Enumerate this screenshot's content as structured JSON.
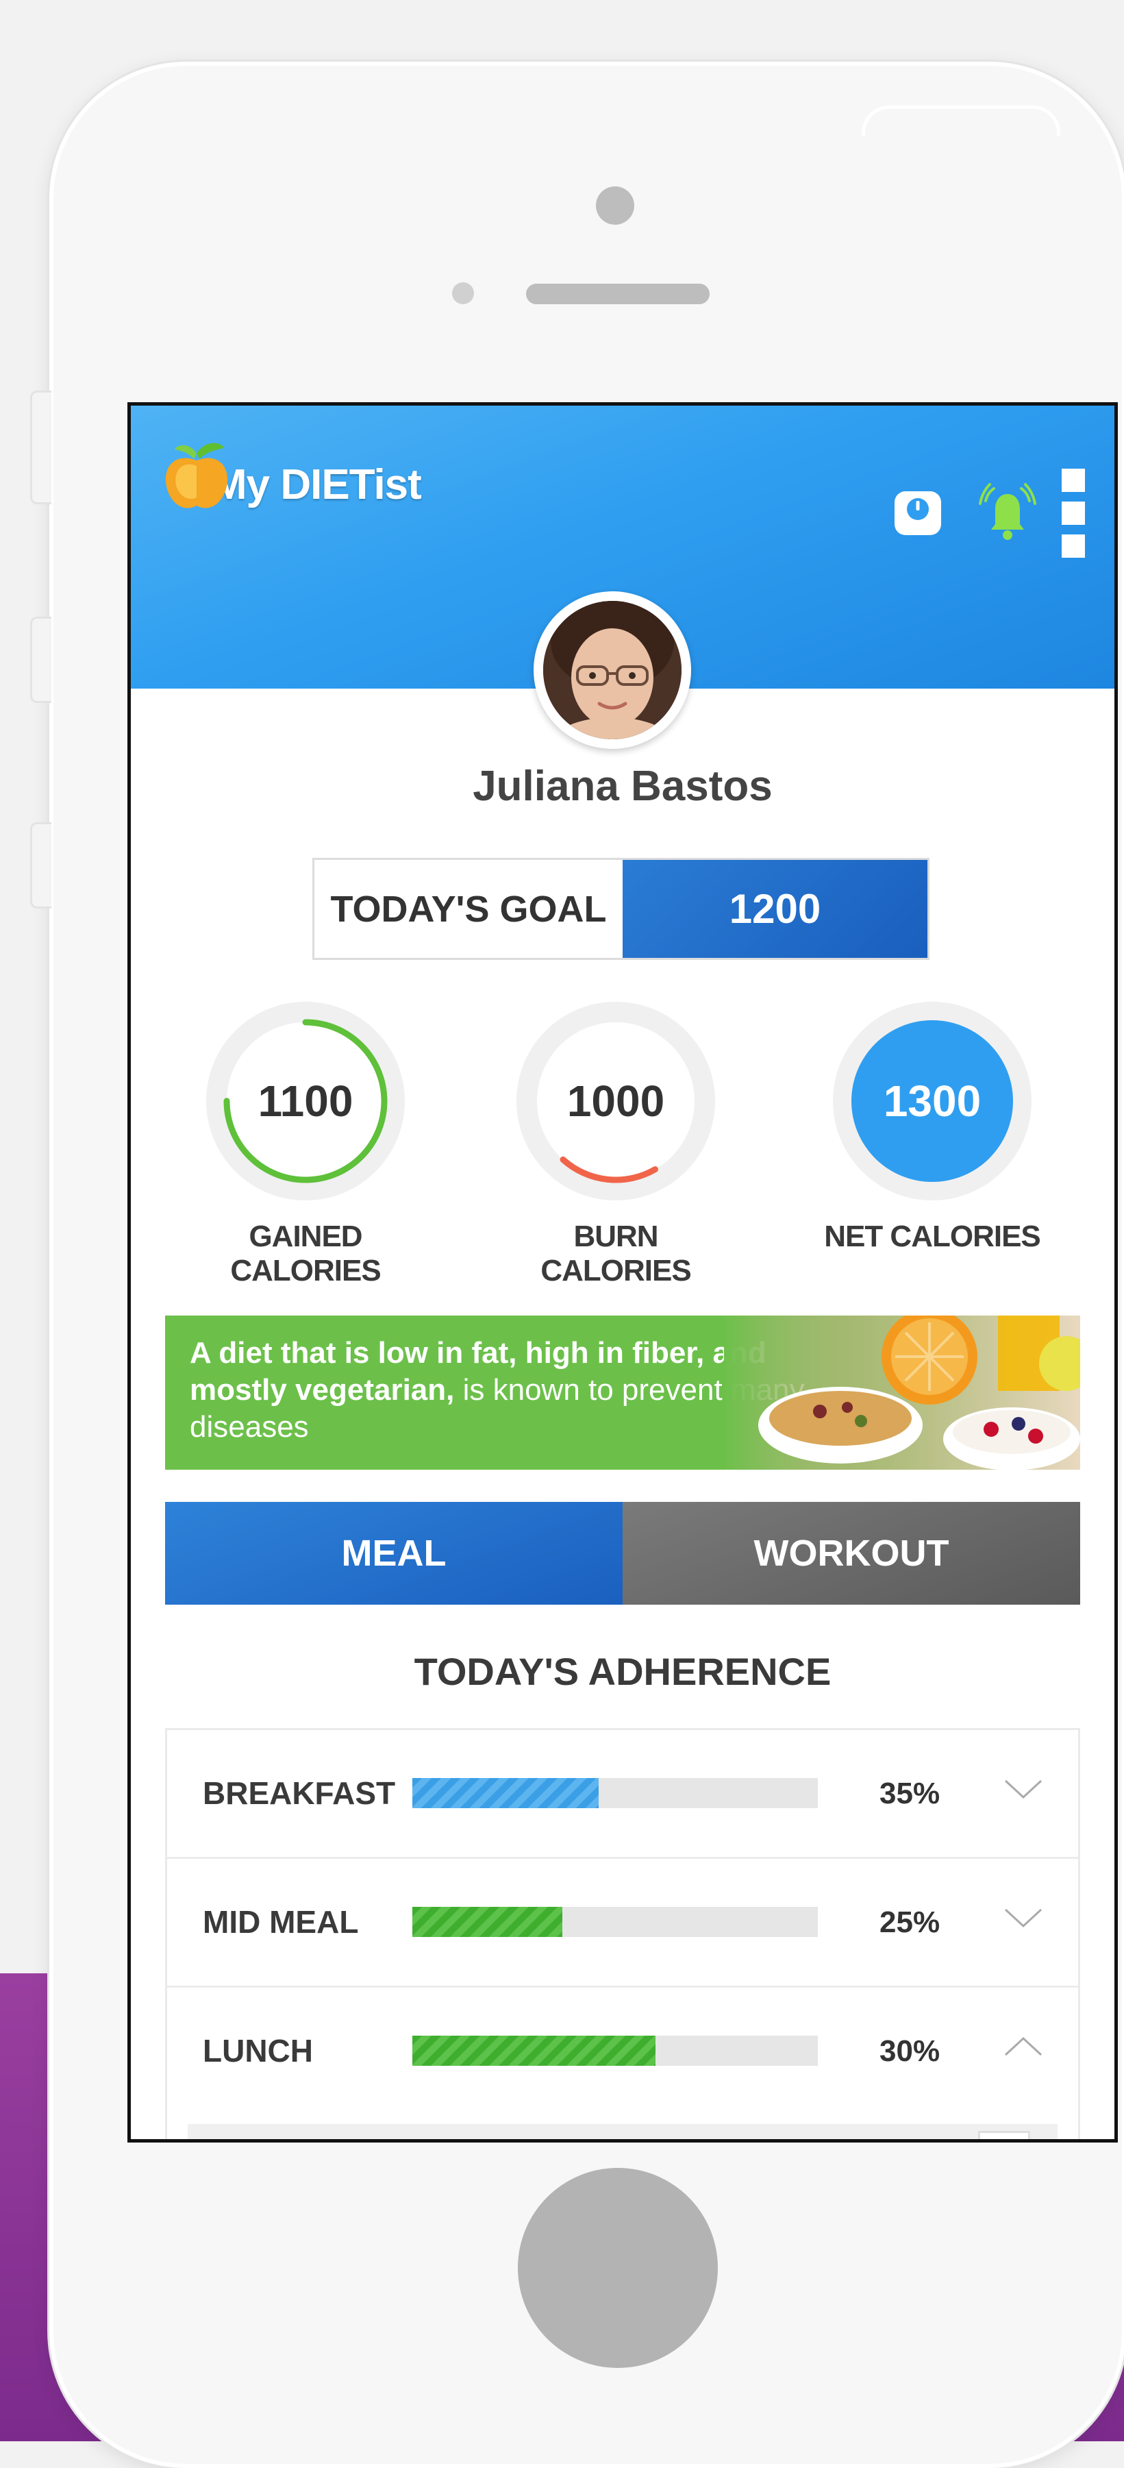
{
  "app": {
    "name": "My DIETist"
  },
  "profile": {
    "name": "Juliana Bastos"
  },
  "goal": {
    "label": "TODAY'S GOAL",
    "value": "1200"
  },
  "stats": [
    {
      "value": "1100",
      "label": "GAINED CALORIES",
      "ring_color": "#5fc03a",
      "progress": 0.75
    },
    {
      "value": "1000",
      "label": "BURN CALORIES",
      "ring_color": "#f0654a",
      "progress": 0.2
    },
    {
      "value": "1300",
      "label": "NET CALORIES",
      "ring_color": "#2f9ef0",
      "progress": 1.0
    }
  ],
  "banner": {
    "bold_text": "A diet that is low in fat, high in fiber, and mostly vegetarian,",
    "normal_text": " is known to prevent many diseases"
  },
  "tabs": {
    "meal": "MEAL",
    "workout": "WORKOUT"
  },
  "adherence": {
    "title": "TODAY'S ADHERENCE",
    "rows": [
      {
        "label": "BREAKFAST",
        "percent": "35%",
        "fill": 0.46,
        "color": "blue",
        "expanded": false
      },
      {
        "label": "MID MEAL",
        "percent": "25%",
        "fill": 0.37,
        "color": "green",
        "expanded": false
      },
      {
        "label": "LUNCH",
        "percent": "30%",
        "fill": 0.6,
        "color": "green",
        "expanded": true
      }
    ]
  },
  "colors": {
    "header_blue": "#2f9ef0",
    "goal_blue": "#1a5fbe",
    "banner_green": "#6cc04a",
    "purple_band": "#8a3496"
  },
  "icons": {
    "header": [
      "weight-scale-icon",
      "notification-bell-icon",
      "more-vertical-icon"
    ]
  }
}
